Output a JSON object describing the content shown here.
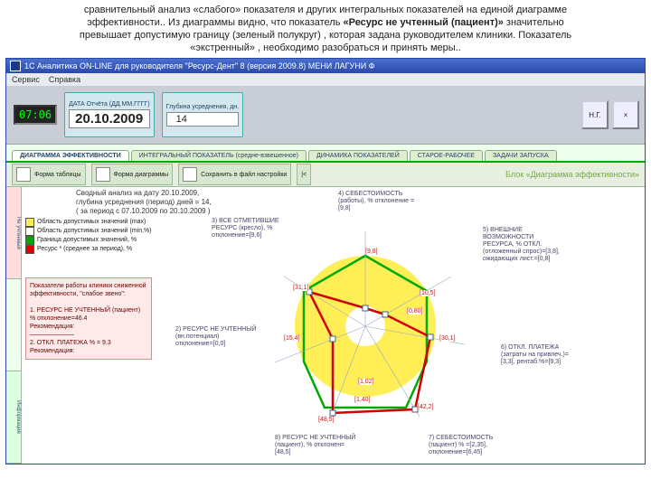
{
  "caption": {
    "l1": "сравнительный анализ «слабого» показателя и других интегральных показателей на единой диаграмме",
    "l2_a": "эффективности.. Из диаграммы видно, что показатель ",
    "l2_b": "«Ресурс не учтенный (пациент)»",
    "l2_c": " значительно",
    "l3": "превышает допустимую границу (зеленый полукруг) , которая задана руководителем клиники. Показатель",
    "l4": "«экстренный» , необходимо разобраться и принять меры.."
  },
  "window": {
    "title": "1С  Аналитика ON-LINE для руководителя \"Ресурс-Дент\" 8 (версия 2009.8)   МЕНИ ЛАГУНИ Ф"
  },
  "menu": {
    "m1": "Сервис",
    "m2": "Справка"
  },
  "params": {
    "date_label": "ДАТА Отчёта (ДД.ММ.ГГГГ)",
    "date": "20.10.2009",
    "depth_label": "Глубина усреднения, дн.",
    "depth": "14",
    "clock": "07:06",
    "btn1": "Н.Г.",
    "btn2": "×"
  },
  "tabs": {
    "t1": "ДИАГРАММА ЭФФЕКТИВНОСТИ",
    "t2": "ИНТЕГРАЛЬНЫЙ ПОКАЗАТЕЛЬ (средне-взвешенное)",
    "t3": "ДИНАМИКА ПОКАЗАТЕЛЕЙ",
    "t4": "СТАРОЕ-РАБОЧЕЕ",
    "t5": "ЗАДАЧИ ЗАПУСКА"
  },
  "tb2": {
    "g1": "Форма таблицы",
    "g2": "Форма диаграммы",
    "g3": "Сохранить в файл настройки",
    "g4": "|<",
    "right": "Блок «Диаграмма эффективности»"
  },
  "side": {
    "s1": "Не учтенный",
    "s2": "",
    "s3": "Информация"
  },
  "header_main": {
    "l1": "Сводный анализ на дату 20.10.2009,",
    "l2": "глубина усреднения (период) дней = 14,",
    "l3": "( за период с 07.10.2009 по 20.10.2009 )"
  },
  "legend": {
    "r1": "Область допустимых значений (max)",
    "r2": "Область допустимых значений (min,%)",
    "r3": "Граница допустимых значений, %",
    "r4": "Ресурс * (среднее за период), %"
  },
  "alert": {
    "t": "Показатели работы клиники сниженной эффективности, \"слабое звено\":",
    "a1": "1. РЕСУРС НЕ УЧТЕННЫЙ (пациент) % отклонение=46.4",
    "a2": "Рекомендация:",
    "d": "———————",
    "a3": "2. ОТКЛ. ПЛАТЕЖА % = 9.3",
    "a4": "Рекомендация:"
  },
  "chart_data": {
    "type": "radar",
    "title": "Диаграмма эффективности",
    "axes": [
      {
        "name": "a0",
        "label": "4) СЕБЕСТОИМОСТЬ (работы), % отклонение = [9,8]",
        "value": 9.8
      },
      {
        "name": "a1",
        "label": "5) ВНЕШНИЕ ВОЗМОЖНОСТИ РЕСУРСА, % ОТКЛ. (отложенный спрос)=[3,8], ожидающих лист.=[0,8]",
        "value": 10.5
      },
      {
        "name": "a2",
        "label": "6) ОТКЛ. ПЛАТЕЖА (затраты на привлеч.)=[3,3], рентаб.%=[9,3]",
        "value": 30.1
      },
      {
        "name": "a3",
        "label": "7) СЕБЕСТОИМОСТЬ (пациент) % =[2,35], отклонение=[6,45]",
        "value": 42.2
      },
      {
        "name": "a4",
        "label": "8) РЕСУРС НЕ УЧТЕННЫЙ (пациент), % отклонен=[48,5]",
        "value": 48.5
      },
      {
        "name": "a5",
        "label": "2) РЕСУРС НЕ УЧТЕННЫЙ (вн.потенциал) отклонение=[0,0]",
        "value": 15.4
      },
      {
        "name": "a6",
        "label": "3) ВСЕ ОТМЕТИВШИЕ РЕСУРС (кресло), % отклонение=[9,6]",
        "value": 31.1
      }
    ],
    "point_labels": [
      "[9,8]",
      "[10,5]",
      "[30,1]",
      "[42,2]",
      "[48,5]",
      "[15,4]",
      "[31,1]",
      "[1,02]",
      "[1,40]",
      "[0,80]"
    ],
    "limit_radius_pct": 50,
    "series": [
      {
        "name": "Ресурс * (среднее за период), %",
        "color": "#d00"
      }
    ]
  }
}
